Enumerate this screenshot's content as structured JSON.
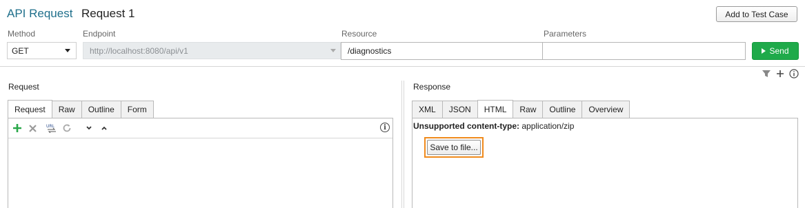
{
  "header": {
    "app_title": "API Request",
    "request_name": "Request 1",
    "add_to_test_case_label": "Add to Test Case"
  },
  "fields": {
    "method_label": "Method",
    "method_value": "GET",
    "endpoint_label": "Endpoint",
    "endpoint_value": "http://localhost:8080/api/v1",
    "resource_label": "Resource",
    "resource_value": "/diagnostics",
    "parameters_label": "Parameters",
    "parameters_value": "",
    "send_label": "Send"
  },
  "toolbar_icons": [
    "filter-icon",
    "plus-icon",
    "info-icon"
  ],
  "request_section": {
    "title": "Request",
    "tabs": [
      "Request",
      "Raw",
      "Outline",
      "Form"
    ],
    "active_tab": "Request",
    "toolbar": [
      "add-icon",
      "delete-icon",
      "url-encode-icon",
      "refresh-icon",
      "move-down-icon",
      "move-up-icon",
      "info-icon"
    ]
  },
  "response_section": {
    "title": "Response",
    "tabs": [
      "XML",
      "JSON",
      "HTML",
      "Raw",
      "Outline",
      "Overview"
    ],
    "active_tab": "HTML",
    "content_type_label": "Unsupported content-type:",
    "content_type_value": "application/zip",
    "save_button_label": "Save to file..."
  },
  "colors": {
    "title_accent": "#1f6f8b",
    "send_green": "#1faa4a",
    "highlight_orange": "#f08a1c"
  }
}
